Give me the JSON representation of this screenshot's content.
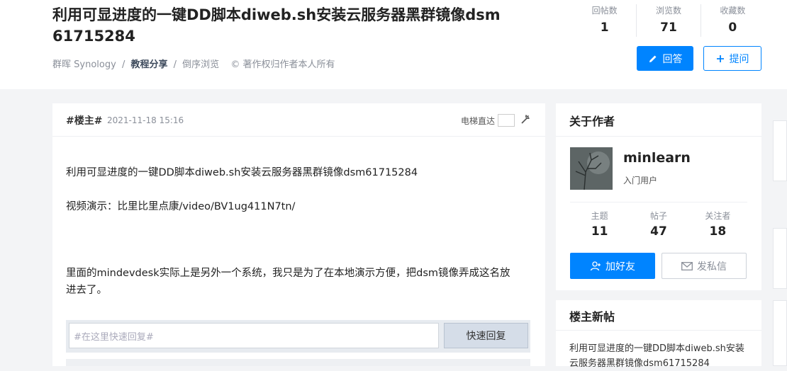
{
  "header": {
    "title": "利用可显进度的一键DD脚本diweb.sh安装云服务器黑群镜像dsm61715284",
    "breadcrumb": {
      "category": "群晖 Synology",
      "subcategory": "教程分享",
      "order": "倒序浏览",
      "copyright": "© 著作权归作者本人所有"
    },
    "stats": [
      {
        "label": "回帖数",
        "value": "1"
      },
      {
        "label": "浏览数",
        "value": "71"
      },
      {
        "label": "收藏数",
        "value": "0"
      }
    ],
    "answer_label": "回答",
    "ask_label": "提问"
  },
  "post": {
    "floor_label": "#楼主#",
    "time": "2021-11-18 15:16",
    "elevator_label": "电梯直达",
    "paragraphs": [
      "利用可显进度的一键DD脚本diweb.sh安装云服务器黑群镜像dsm61715284",
      "视频演示：比里比里点康/video/BV1ug411N7tn/",
      "里面的mindevdesk实际上是另外一个系统，我只是为了在本地演示方便，把dsm镜像弄成这名放进去了。"
    ],
    "reply_placeholder": "#在这里快速回复#",
    "reply_button": "快速回复"
  },
  "author": {
    "section_title": "关于作者",
    "name": "minlearn",
    "role": "入门用户",
    "stats": [
      {
        "label": "主题",
        "value": "11"
      },
      {
        "label": "帖子",
        "value": "47"
      },
      {
        "label": "关注者",
        "value": "18"
      }
    ],
    "add_friend_label": "加好友",
    "message_label": "发私信"
  },
  "new_posts": {
    "section_title": "楼主新帖",
    "items": [
      "利用可显进度的一键DD脚本diweb.sh安装云服务器黑群镜像dsm61715284"
    ]
  },
  "colors": {
    "accent": "#0084ff",
    "background": "#f3f4f6"
  }
}
